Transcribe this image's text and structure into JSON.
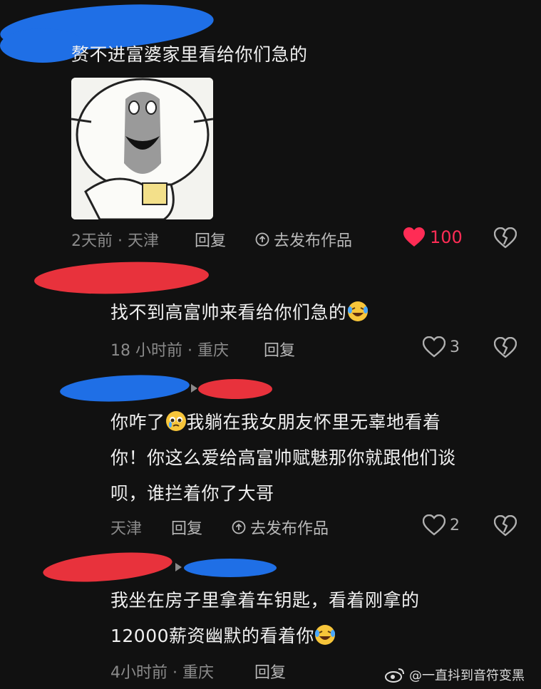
{
  "comments": [
    {
      "text": "赘不进富婆家里看给你们急的",
      "time_location": "2天前 · 天津",
      "reply_label": "回复",
      "publish_label": "去发布作品",
      "likes": "100"
    },
    {
      "text": "找不到高富帅来看给你们急的",
      "time_location": "18 小时前 · 重庆",
      "reply_label": "回复",
      "likes": "3"
    },
    {
      "line1": "你咋了",
      "line1b": "我躺在我女朋友怀里无辜地看着",
      "line2": "你！你这么爱给高富帅赋魅那你就跟他们谈",
      "line3": "呗，谁拦着你了大哥",
      "time_location": "天津",
      "reply_label": "回复",
      "publish_label": "去发布作品",
      "likes": "2"
    },
    {
      "line1": "我坐在房子里拿着车钥匙，看着刚拿的",
      "line2": "12000薪资幽默的看着你",
      "time_location": "4小时前 · 重庆",
      "reply_label": "回复"
    }
  ],
  "watermark": "@一直抖到音符变黑",
  "colors": {
    "background": "#111111",
    "like_active": "#ff2c55",
    "scribble_blue": "#1f6fe6",
    "scribble_red": "#e8323c"
  },
  "icons": [
    "heart-filled-icon",
    "heart-outline-icon",
    "broken-heart-icon",
    "publish-icon",
    "laughing-crying-emoji",
    "pleading-emoji",
    "weibo-logo"
  ]
}
